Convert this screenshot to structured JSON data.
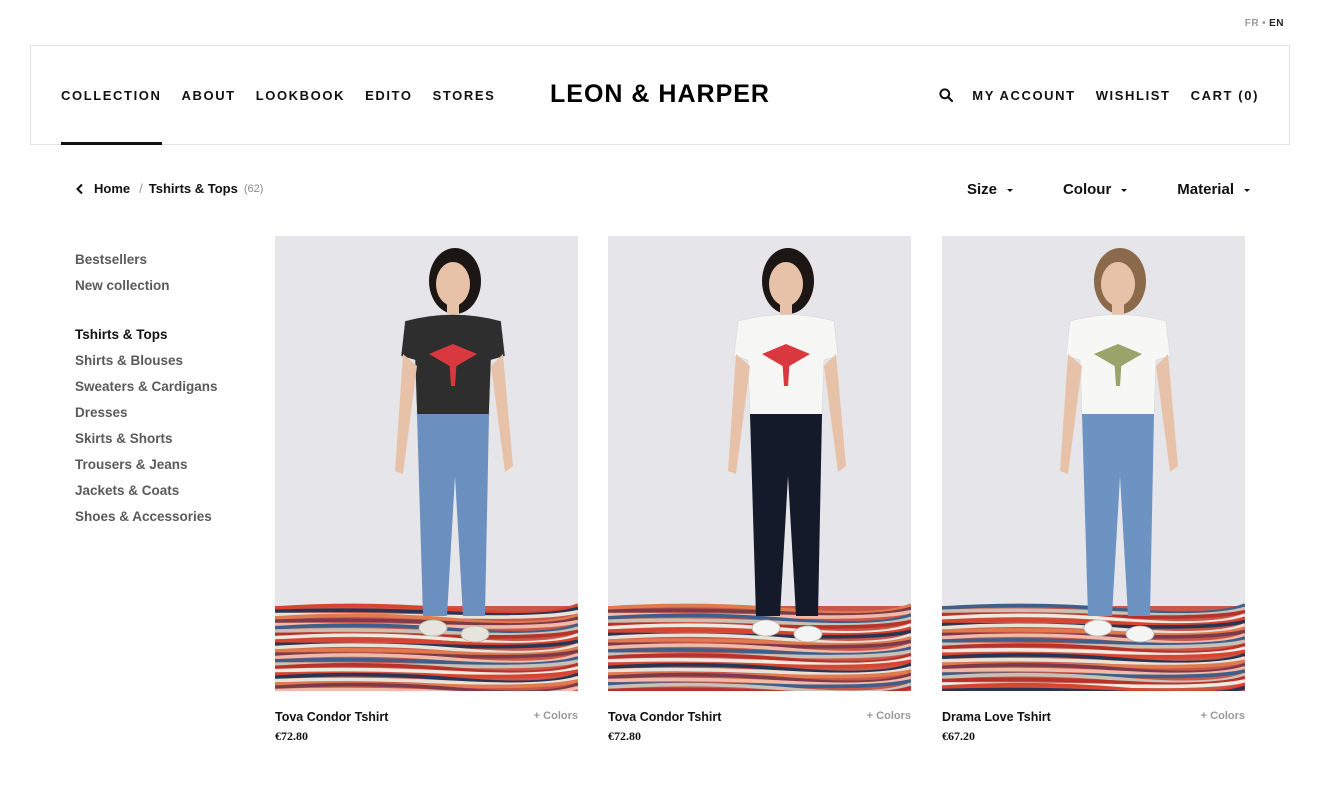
{
  "lang": {
    "fr": "FR",
    "separator": "•",
    "en": "EN"
  },
  "nav_left": [
    "COLLECTION",
    "ABOUT",
    "LOOKBOOK",
    "EDITO",
    "STORES"
  ],
  "logo": "LEON & HARPER",
  "nav_right": {
    "account": "MY ACCOUNT",
    "wishlist": "WISHLIST",
    "cart": "CART (0)"
  },
  "breadcrumb": {
    "home": "Home",
    "separator": "/",
    "current": "Tshirts & Tops",
    "count": "(62)"
  },
  "filters": [
    "Size",
    "Colour",
    "Material"
  ],
  "sidebar": {
    "featured": [
      "Bestsellers",
      "New collection"
    ],
    "categories": [
      "Tshirts & Tops",
      "Shirts & Blouses",
      "Sweaters & Cardigans",
      "Dresses",
      "Skirts & Shorts",
      "Trousers & Jeans",
      "Jackets & Coats",
      "Shoes & Accessories"
    ],
    "active": "Tshirts & Tops"
  },
  "products": [
    {
      "name": "Tova Condor Tshirt",
      "colors_label": "+ Colors",
      "price": "€72.80",
      "top_color": "#2f2e2e",
      "bottom_color": "#6b8fbf",
      "print_color": "#d9383e",
      "shoe_color": "#e7e4de"
    },
    {
      "name": "Tova Condor Tshirt",
      "colors_label": "+ Colors",
      "price": "€72.80",
      "top_color": "#f6f6f4",
      "bottom_color": "#141a2a",
      "print_color": "#d9383e",
      "shoe_color": "#f4f4f4"
    },
    {
      "name": "Drama Love Tshirt",
      "colors_label": "+ Colors",
      "price": "€67.20",
      "top_color": "#f7f7f5",
      "bottom_color": "#6d93c2",
      "print_color": "#9aa36a",
      "shoe_color": "#f4f4f4"
    }
  ],
  "colors": {
    "text": "#111111",
    "muted": "#5a5a5a",
    "border": "#e2e2e2",
    "photo_background": "#e6e5e9"
  }
}
